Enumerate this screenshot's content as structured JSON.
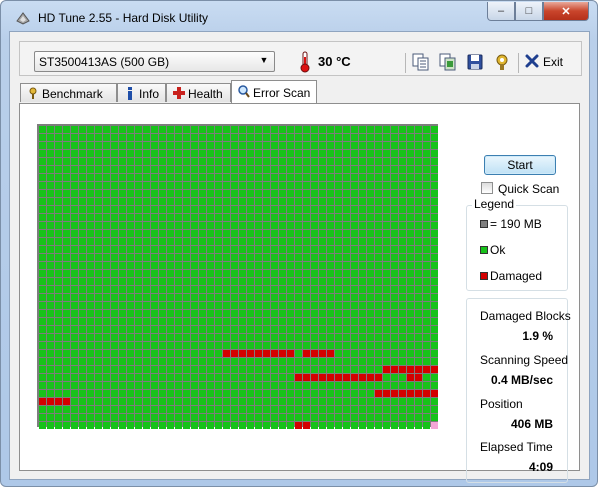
{
  "window": {
    "title": "HD Tune 2.55 - Hard Disk Utility",
    "min_glyph": "–",
    "max_glyph": "□",
    "close_glyph": "✕"
  },
  "toolbar": {
    "drive": "ST3500413AS (500 GB)",
    "dropdown_glyph": "▼",
    "temperature": "30 °C",
    "exit_label": "Exit",
    "icons": [
      "copy-text-icon",
      "copy-screenshot-icon",
      "save-icon",
      "options-icon",
      "exit-icon"
    ]
  },
  "tabs": [
    {
      "label": "Benchmark",
      "icon": "benchmark-icon",
      "active": false
    },
    {
      "label": "Info",
      "icon": "info-icon",
      "active": false
    },
    {
      "label": "Health",
      "icon": "health-icon",
      "active": false
    },
    {
      "label": "Error Scan",
      "icon": "magnifier-icon",
      "active": true
    }
  ],
  "scan_map": {
    "columns": 50,
    "rows": 38,
    "colors": {
      "ok": "#17c21a",
      "damaged": "#d30000",
      "current": "#f4a6d6"
    },
    "damaged_runs": [
      {
        "row": 28,
        "from": 23,
        "to": 31
      },
      {
        "row": 28,
        "from": 33,
        "to": 36
      },
      {
        "row": 30,
        "from": 43,
        "to": 49
      },
      {
        "row": 31,
        "from": 32,
        "to": 42
      },
      {
        "row": 31,
        "from": 46,
        "to": 47
      },
      {
        "row": 33,
        "from": 42,
        "to": 49
      },
      {
        "row": 34,
        "from": 0,
        "to": 3
      },
      {
        "row": 37,
        "from": 32,
        "to": 33
      }
    ],
    "current_block": {
      "row": 37,
      "col": 49
    }
  },
  "controls": {
    "start_label": "Start",
    "quick_scan_label": "Quick Scan",
    "quick_scan_checked": false
  },
  "legend": {
    "title": "Legend",
    "items": [
      {
        "label": "= 190 MB",
        "color": "#808080"
      },
      {
        "label": "Ok",
        "color": "#17c21a"
      },
      {
        "label": "Damaged",
        "color": "#d30000"
      }
    ]
  },
  "stats": {
    "damaged_blocks": {
      "label": "Damaged Blocks",
      "value": "1.9 %"
    },
    "scanning_speed": {
      "label": "Scanning Speed",
      "value": "0.4 MB/sec"
    },
    "position": {
      "label": "Position",
      "value": "406 MB"
    },
    "elapsed_time": {
      "label": "Elapsed Time",
      "value": "4:09"
    }
  }
}
